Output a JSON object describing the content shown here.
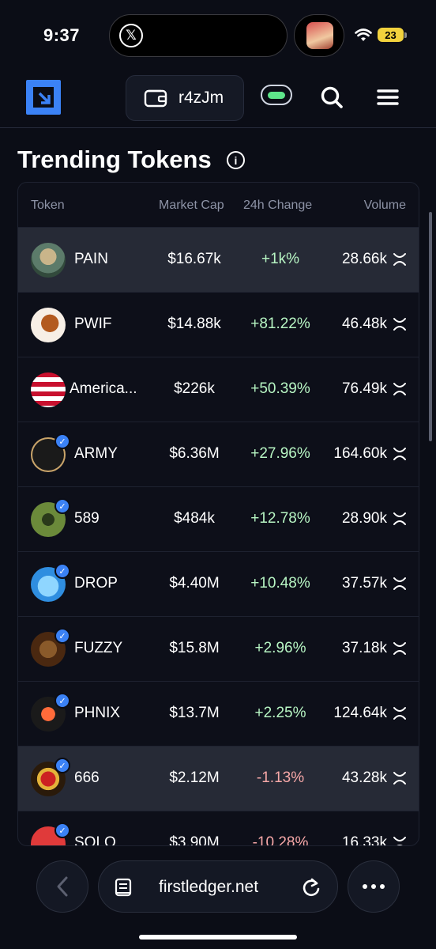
{
  "status_bar": {
    "time": "9:37",
    "battery": "23"
  },
  "header": {
    "wallet_label": "r4zJm",
    "logo_icon": "firstledger-logo",
    "accent": "#3b82f6"
  },
  "page": {
    "title": "Trending Tokens"
  },
  "table": {
    "columns": [
      "Token",
      "Market Cap",
      "24h Change",
      "Volume"
    ],
    "rows": [
      {
        "name": "PAIN",
        "market_cap": "$16.67k",
        "change": "+1k%",
        "volume": "28.66k",
        "verified": false,
        "direction": "pos",
        "highlight": true
      },
      {
        "name": "PWIF",
        "market_cap": "$14.88k",
        "change": "+81.22%",
        "volume": "46.48k",
        "verified": false,
        "direction": "pos",
        "highlight": false
      },
      {
        "name": "America...",
        "market_cap": "$226k",
        "change": "+50.39%",
        "volume": "76.49k",
        "verified": false,
        "direction": "pos",
        "highlight": false
      },
      {
        "name": "ARMY",
        "market_cap": "$6.36M",
        "change": "+27.96%",
        "volume": "164.60k",
        "verified": true,
        "direction": "pos",
        "highlight": false
      },
      {
        "name": "589",
        "market_cap": "$484k",
        "change": "+12.78%",
        "volume": "28.90k",
        "verified": true,
        "direction": "pos",
        "highlight": false
      },
      {
        "name": "DROP",
        "market_cap": "$4.40M",
        "change": "+10.48%",
        "volume": "37.57k",
        "verified": true,
        "direction": "pos",
        "highlight": false
      },
      {
        "name": "FUZZY",
        "market_cap": "$15.8M",
        "change": "+2.96%",
        "volume": "37.18k",
        "verified": true,
        "direction": "pos",
        "highlight": false
      },
      {
        "name": "PHNIX",
        "market_cap": "$13.7M",
        "change": "+2.25%",
        "volume": "124.64k",
        "verified": true,
        "direction": "pos",
        "highlight": false
      },
      {
        "name": "666",
        "market_cap": "$2.12M",
        "change": "-1.13%",
        "volume": "43.28k",
        "verified": true,
        "direction": "neg",
        "highlight": true
      },
      {
        "name": "SOLO",
        "market_cap": "$3.90M",
        "change": "-10.28%",
        "volume": "16.33k",
        "verified": true,
        "direction": "neg",
        "highlight": false
      }
    ],
    "volume_icon": "xrp-icon",
    "positive_color": "#b7f5c3",
    "negative_color": "#f7a8a8"
  },
  "browser": {
    "url": "firstledger.net"
  }
}
